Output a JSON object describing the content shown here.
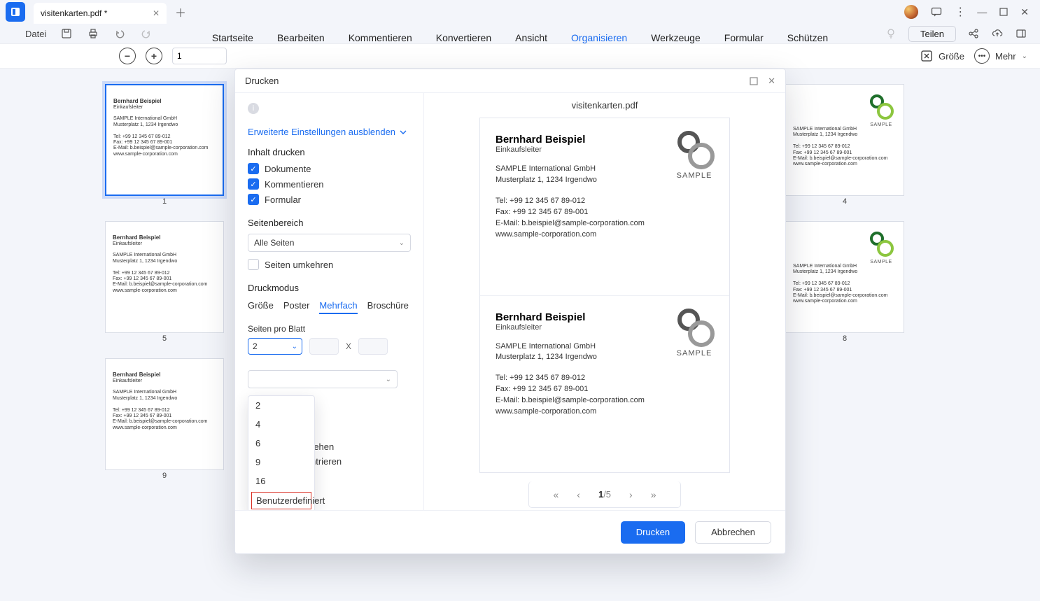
{
  "chrome": {
    "tab_title": "visitenkarten.pdf *",
    "file_menu": "Datei"
  },
  "main_tabs": [
    "Startseite",
    "Bearbeiten",
    "Kommentieren",
    "Konvertieren",
    "Ansicht",
    "Organisieren",
    "Werkzeuge",
    "Formular",
    "Schützen"
  ],
  "active_main_tab": "Organisieren",
  "share_label": "Teilen",
  "toolbar": {
    "page_value": "1",
    "size_label": "Größe",
    "more_label": "Mehr"
  },
  "thumbs": {
    "numbers": [
      "1",
      "4",
      "5",
      "8",
      "9"
    ],
    "card": {
      "name": "Bernhard Beispiel",
      "role": "Einkaufsleiter",
      "addr1": "SAMPLE International GmbH",
      "addr2": "Musterplatz 1, 1234 Irgendwo",
      "tel": "Tel:  +99 12 345 67 89-012",
      "fax": "Fax: +99 12 345 67 89-001",
      "mail": "E-Mail: b.beispiel@sample-corporation.com",
      "web": "www.sample-corporation.com",
      "logo_label": "SAMPLE"
    }
  },
  "dialog": {
    "title": "Drucken",
    "filename": "visitenkarten.pdf",
    "advanced_link": "Erweiterte Einstellungen ausblenden",
    "section_content": "Inhalt drucken",
    "cb_doc": "Dokumente",
    "cb_comment": "Kommentieren",
    "cb_form": "Formular",
    "section_range": "Seitenbereich",
    "range_value": "Alle Seiten",
    "reverse_label": "Seiten umkehren",
    "section_mode": "Druckmodus",
    "mode_tabs": [
      "Größe",
      "Poster",
      "Mehrfach",
      "Broschüre"
    ],
    "mode_active": "Mehrfach",
    "ppb_label": "Seiten pro Blatt",
    "ppb_value": "2",
    "ppb_x": "X",
    "ppb_options": [
      "2",
      "4",
      "6",
      "9",
      "16",
      "Benutzerdefiniert"
    ],
    "partial1": "rehen",
    "partial2": "ntrieren",
    "pager": {
      "current": "1",
      "total": "/5"
    },
    "card": {
      "name": "Bernhard Beispiel",
      "role": "Einkaufsleiter",
      "addr1": "SAMPLE International GmbH",
      "addr2": "Musterplatz 1, 1234 Irgendwo",
      "tel": "Tel:  +99 12 345 67 89-012",
      "fax": "Fax:  +99 12 345 67 89-001",
      "mail": "E-Mail: b.beispiel@sample-corporation.com",
      "web": "www.sample-corporation.com",
      "logo_label": "SAMPLE"
    },
    "ok": "Drucken",
    "cancel": "Abbrechen"
  }
}
